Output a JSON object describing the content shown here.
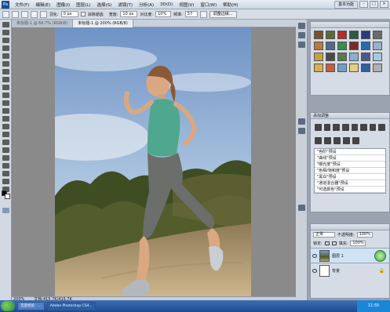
{
  "app": {
    "logo": "Ps",
    "menus": [
      "文件(F)",
      "编辑(E)",
      "图像(I)",
      "图层(L)",
      "选择(S)",
      "滤镜(T)",
      "分析(A)",
      "3D(D)",
      "视图(V)",
      "窗口(W)",
      "帮助(H)"
    ],
    "workspace": "基本功能",
    "window_buttons": [
      "–",
      "□",
      "×"
    ]
  },
  "options": {
    "feather_label": "羽化:",
    "feather_value": "0 px",
    "antialias_label": "消除锯齿",
    "width_label": "宽度:",
    "width_value": "10 px",
    "contrast_label": "对比度:",
    "contrast_value": "10%",
    "frequency_label": "频率:",
    "frequency_value": "57",
    "refine_edge": "调整边缘..."
  },
  "tabs": [
    {
      "label": "未标题-1 @ 66.7% (RGB/8)",
      "active": false
    },
    {
      "label": "未标题-1 @ 200% (RGB/8)",
      "active": true
    }
  ],
  "status": {
    "zoom": "200%",
    "doc": "文档:415.7K/415.7K"
  },
  "panels": {
    "styles_title": "",
    "adjust_title": "添加调整",
    "adjust_items": [
      "\"色阶\"预设",
      "\"曲线\"预设",
      "\"曝光度\"预设",
      "\"色相/饱和度\"预设",
      "\"黑白\"预设",
      "\"通道混合器\"预设",
      "\"可选颜色\"预设"
    ],
    "layers": {
      "blend_mode": "正常",
      "opacity_label": "不透明度:",
      "opacity_value": "100%",
      "lock_label": "锁定:",
      "fill_label": "填充:",
      "fill_value": "100%",
      "rows": [
        {
          "name": "图层 1",
          "selected": true
        },
        {
          "name": "背景",
          "selected": false
        }
      ]
    }
  },
  "taskbar": {
    "items": [
      "百度经验 - ...",
      "Adobe Photoshop CS4..."
    ],
    "tray": "11:55"
  },
  "colors": {
    "sky": "#8aa9cf",
    "shrub": "#3d4a1f",
    "sand": "#b8a07a",
    "tank_top": "#4fa88d",
    "leggings": "#6b6e6a"
  },
  "style_swatches": [
    "#7a5230",
    "#5a6b3a",
    "#b32d2a",
    "#2d5b3e",
    "#2a3b7a",
    "#6b6b6b",
    "#b77a42",
    "#4f6a8a",
    "#3a8a4a",
    "#7a2a2a",
    "#2a6ab0",
    "#9ab0c8",
    "#c9a040",
    "#4b4b4b",
    "#5b7a4a",
    "#8ab0d0",
    "#4a5a8a",
    "#a8c8e0",
    "#d8b050",
    "#c06040",
    "#70a0c0",
    "#e0d080",
    "#3060a0",
    "#b0b0b0"
  ]
}
